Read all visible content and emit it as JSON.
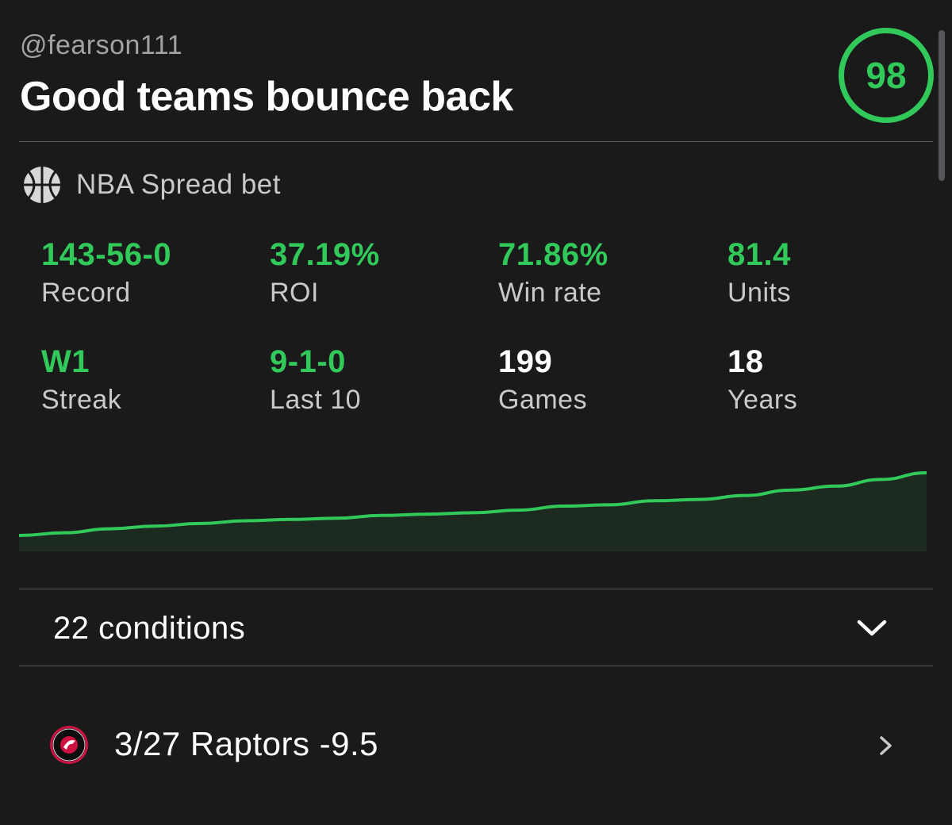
{
  "header": {
    "handle": "@fearson111",
    "title": "Good teams bounce back",
    "score": "98"
  },
  "bet": {
    "sport_icon": "basketball-icon",
    "type_label": "NBA Spread bet"
  },
  "stats": [
    {
      "value": "143-56-0",
      "label": "Record",
      "accent": "#31c95a"
    },
    {
      "value": "37.19%",
      "label": "ROI",
      "accent": "#31c95a"
    },
    {
      "value": "71.86%",
      "label": "Win rate",
      "accent": "#31c95a"
    },
    {
      "value": "81.4",
      "label": "Units",
      "accent": "#31c95a"
    },
    {
      "value": "W1",
      "label": "Streak",
      "accent": "#31c95a"
    },
    {
      "value": "9-1-0",
      "label": "Last 10",
      "accent": "#31c95a"
    },
    {
      "value": "199",
      "label": "Games",
      "accent": "#ffffff"
    },
    {
      "value": "18",
      "label": "Years",
      "accent": "#ffffff"
    }
  ],
  "chart_data": {
    "type": "area",
    "x": [
      0,
      1,
      2,
      3,
      4,
      5,
      6,
      7,
      8,
      9,
      10,
      11,
      12,
      13,
      14,
      15,
      16,
      17,
      18,
      19,
      20
    ],
    "values": [
      0,
      2,
      5,
      7,
      9,
      11,
      12,
      13,
      15,
      16,
      17,
      19,
      22,
      23,
      26,
      27,
      30,
      34,
      37,
      42,
      47
    ],
    "title": "",
    "xlabel": "",
    "ylabel": "",
    "ylim": [
      0,
      50
    ],
    "grid": false,
    "line_color": "#31c95a",
    "fill_color": "#1c2a1f"
  },
  "conditions": {
    "label": "22 conditions",
    "chevron_icon": "chevron-down-icon"
  },
  "game": {
    "team_icon": "raptors-logo-icon",
    "label": "3/27 Raptors -9.5",
    "chevron_icon": "chevron-right-icon"
  },
  "colors": {
    "accent": "#31c95a",
    "background": "#1b1a1b",
    "divider": "#58585c"
  }
}
